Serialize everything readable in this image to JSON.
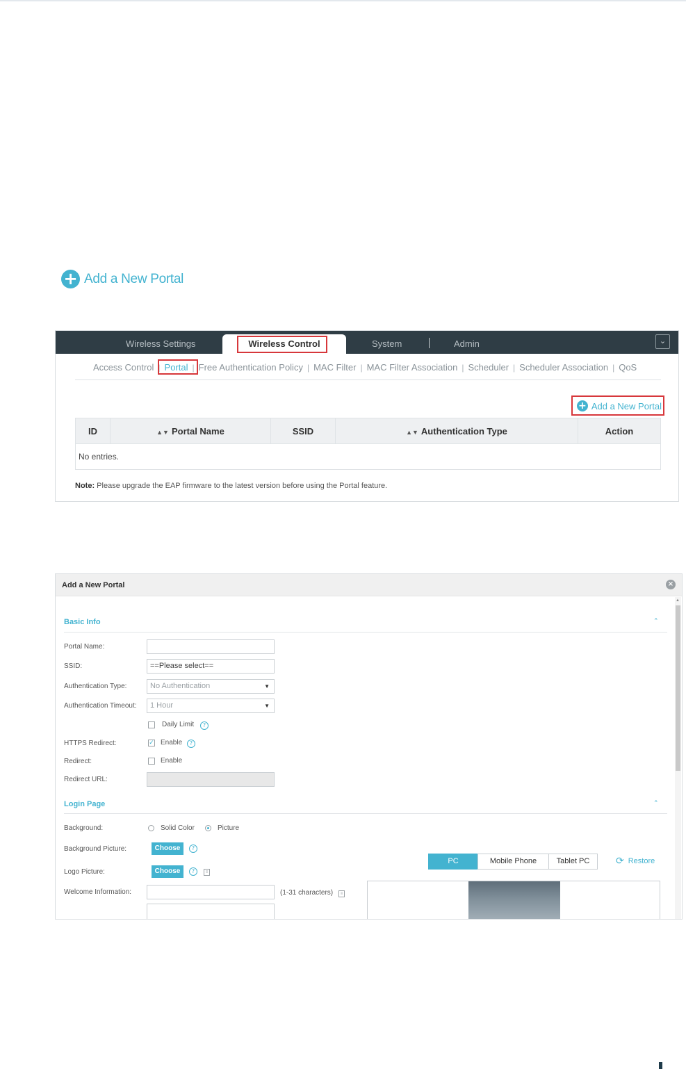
{
  "heading": {
    "add_label": "Add a New Portal"
  },
  "controller": {
    "top_tabs": [
      "Wireless Settings",
      "Wireless Control",
      "System",
      "Admin"
    ],
    "active_top_tab": "Wireless Control",
    "sub_tabs": [
      "Access Control",
      "Portal",
      "Free Authentication Policy",
      "MAC Filter",
      "MAC Filter Association",
      "Scheduler",
      "Scheduler Association",
      "QoS"
    ],
    "active_sub_tab": "Portal",
    "add_button": "Add a New Portal",
    "table": {
      "columns": [
        "ID",
        "Portal Name",
        "SSID",
        "Authentication Type",
        "Action"
      ],
      "empty_text": "No entries."
    },
    "note_label": "Note:",
    "note_text": "Please upgrade the EAP firmware to the latest version before using the Portal feature."
  },
  "dialog": {
    "title": "Add a New Portal",
    "basic_info": {
      "section_title": "Basic Info",
      "portal_name_label": "Portal Name:",
      "portal_name_value": "",
      "ssid_label": "SSID:",
      "ssid_value": "==Please select==",
      "auth_type_label": "Authentication Type:",
      "auth_type_value": "No Authentication",
      "auth_timeout_label": "Authentication Timeout:",
      "auth_timeout_value": "1 Hour",
      "daily_limit_label": "Daily Limit",
      "daily_limit_checked": false,
      "https_redirect_label": "HTTPS Redirect:",
      "https_enable_label": "Enable",
      "https_enable_checked": true,
      "redirect_label": "Redirect:",
      "redirect_enable_label": "Enable",
      "redirect_enable_checked": false,
      "redirect_url_label": "Redirect URL:",
      "redirect_url_value": ""
    },
    "login_page": {
      "section_title": "Login Page",
      "background_label": "Background:",
      "background_options": [
        "Solid Color",
        "Picture"
      ],
      "background_selected": "Picture",
      "background_picture_label": "Background Picture:",
      "logo_picture_label": "Logo Picture:",
      "choose_label": "Choose",
      "welcome_label": "Welcome Information:",
      "welcome_hint": "(1-31 characters)",
      "welcome_value": "",
      "preview_devices": [
        "PC",
        "Mobile Phone",
        "Tablet PC"
      ],
      "preview_selected": "PC",
      "restore_label": "Restore"
    }
  },
  "colors": {
    "accent": "#43b3d0",
    "nav_bg": "#2f3d45",
    "highlight": "#d7373b"
  }
}
